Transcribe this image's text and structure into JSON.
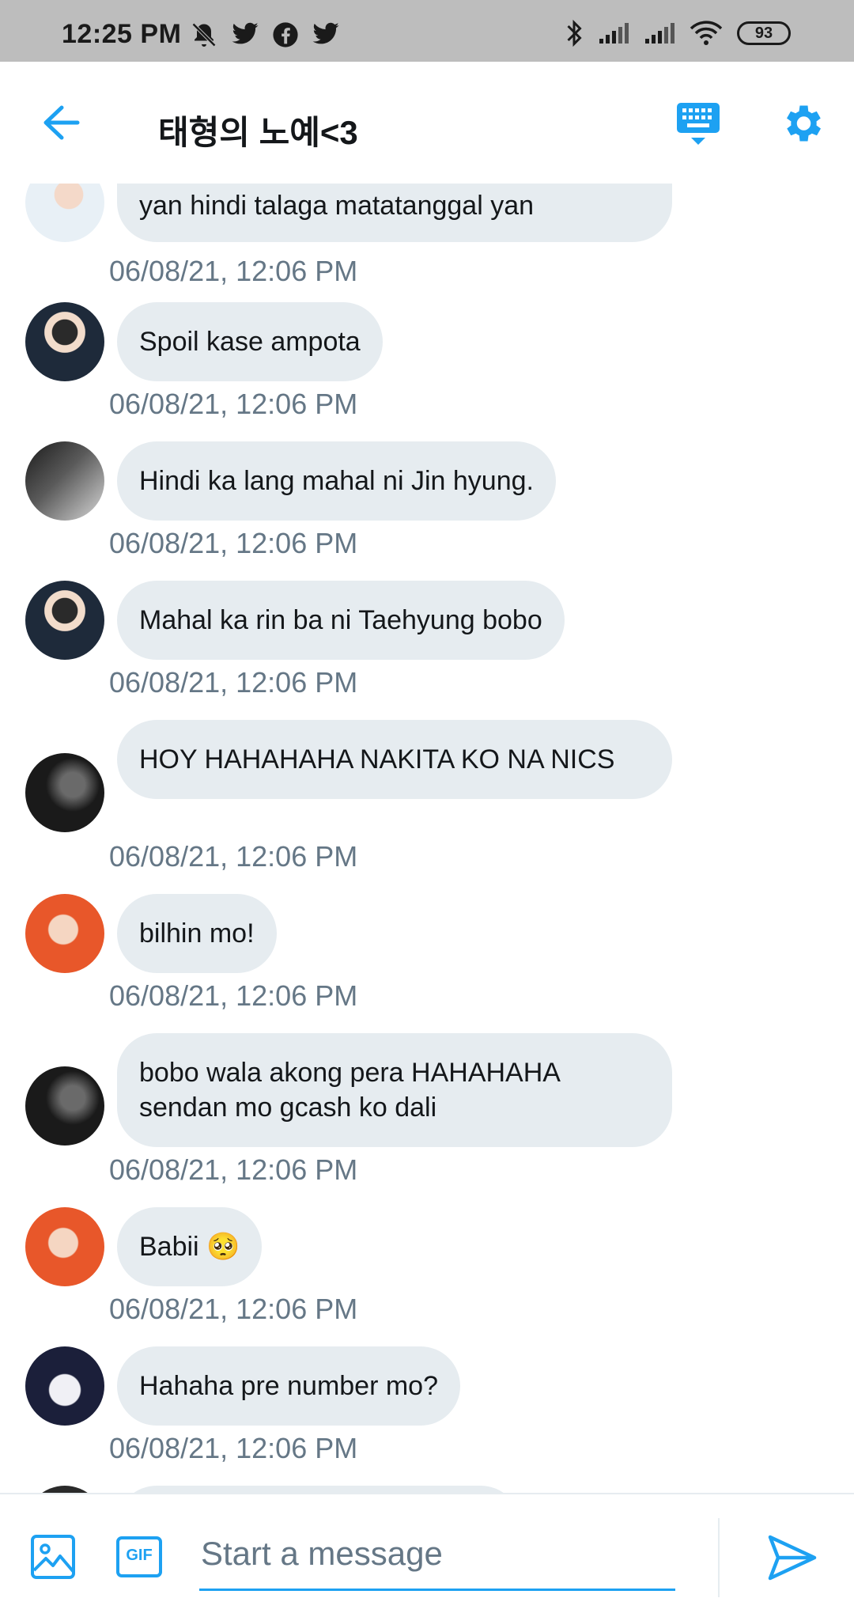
{
  "status_bar": {
    "time": "12:25 PM",
    "left_icons": [
      "mute-icon",
      "twitter-icon",
      "facebook-icon",
      "twitter-icon"
    ],
    "right_icons": [
      "bluetooth-icon",
      "signal-icon",
      "signal-icon",
      "wifi-icon"
    ],
    "battery": "93"
  },
  "header": {
    "title": "태형의 노예<3"
  },
  "messages": [
    {
      "text": "yan hindi talaga matatanggal yan",
      "time": "06/08/21, 12:06 PM",
      "avatar_color": "#e8f0f6"
    },
    {
      "text": "Spoil kase ampota",
      "time": "06/08/21, 12:06 PM",
      "avatar_color": "#c9c6c0"
    },
    {
      "text": "Hindi ka lang mahal ni Jin hyung.",
      "time": "06/08/21, 12:06 PM",
      "avatar_color": "#6e6e6e"
    },
    {
      "text": "Mahal ka rin ba ni Taehyung bobo",
      "time": "06/08/21, 12:06 PM",
      "avatar_color": "#c9c6c0"
    },
    {
      "text": "HOY HAHAHAHA NAKITA KO NA NICS",
      "time": "06/08/21, 12:06 PM",
      "avatar_color": "#2a2a2a"
    },
    {
      "text": "bilhin mo!",
      "time": "06/08/21, 12:06 PM",
      "avatar_color": "#e8572a"
    },
    {
      "text": "bobo wala akong pera HAHAHAHA sendan mo gcash ko dali",
      "time": "06/08/21, 12:06 PM",
      "avatar_color": "#2a2a2a"
    },
    {
      "text": "Babii 🥺",
      "time": "06/08/21, 12:06 PM",
      "avatar_color": "#e8572a"
    },
    {
      "text": "Hahaha pre number mo?",
      "time": "06/08/21, 12:06 PM",
      "avatar_color": "#1b1f3a"
    }
  ],
  "composer": {
    "placeholder": "Start a message",
    "gif_label": "GIF"
  },
  "colors": {
    "accent": "#1da1f2",
    "bubble": "#e6ecf0",
    "timestamp": "#657786"
  }
}
